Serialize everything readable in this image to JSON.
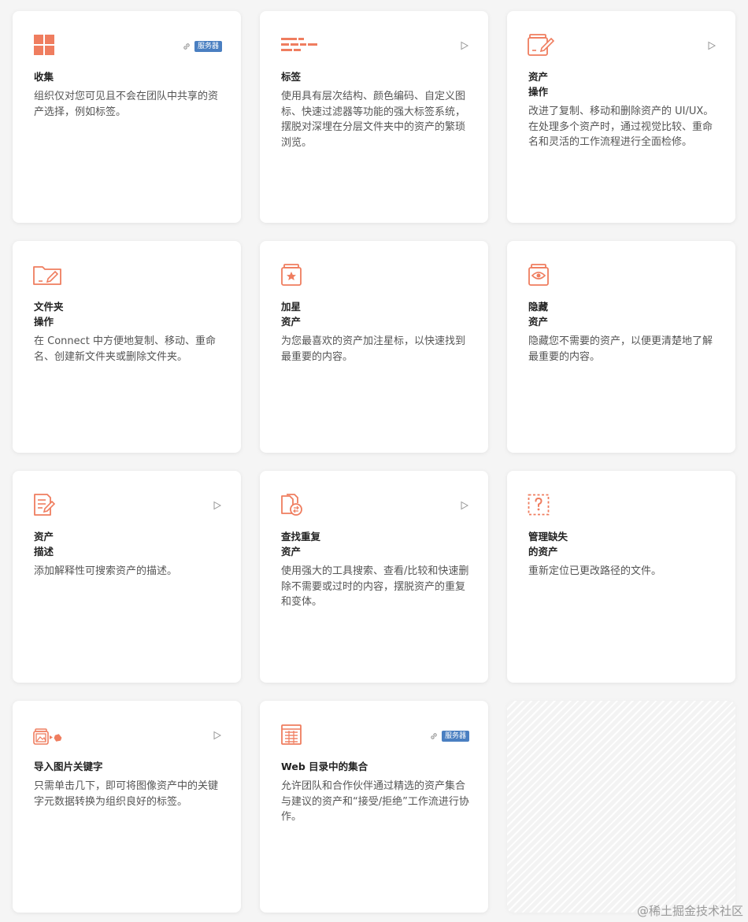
{
  "cards": [
    {
      "title1": "收集",
      "title2": "",
      "desc": "组织仅对您可见且不会在团队中共享的资产选择，例如标签。",
      "corner": "link-badge",
      "badge": "服务器",
      "icon": "grid-icon"
    },
    {
      "title1": "标签",
      "title2": "",
      "desc": "使用具有层次结构、颜色编码、自定义图标、快速过滤器等功能的强大标签系统，摆脱对深埋在分层文件夹中的资产的繁琐浏览。",
      "corner": "play",
      "icon": "tags-icon"
    },
    {
      "title1": "资产",
      "title2": "操作",
      "desc": "改进了复制、移动和删除资产的 UI/UX。在处理多个资产时，通过视觉比较、重命名和灵活的工作流程进行全面检修。",
      "corner": "play",
      "icon": "asset-edit-icon"
    },
    {
      "title1": "文件夹",
      "title2": "操作",
      "desc": "在 Connect 中方便地复制、移动、重命名、创建新文件夹或删除文件夹。",
      "corner": "none",
      "icon": "folder-edit-icon"
    },
    {
      "title1": "加星",
      "title2": "资产",
      "desc": "为您最喜欢的资产加注星标，以快速找到最重要的内容。",
      "corner": "none",
      "icon": "star-asset-icon"
    },
    {
      "title1": "隐藏",
      "title2": "资产",
      "desc": "隐藏您不需要的资产，以便更清楚地了解最重要的内容。",
      "corner": "none",
      "icon": "hidden-asset-icon"
    },
    {
      "title1": "资产",
      "title2": "描述",
      "desc": "添加解释性可搜索资产的描述。",
      "corner": "play",
      "icon": "description-icon"
    },
    {
      "title1": "查找重复",
      "title2": "资产",
      "desc": "使用强大的工具搜索、查看/比较和快速删除不需要或过时的内容，摆脱资产的重复和变体。",
      "corner": "play",
      "icon": "duplicate-icon"
    },
    {
      "title1": "管理缺失",
      "title2": "的资产",
      "desc": "重新定位已更改路径的文件。",
      "corner": "none",
      "icon": "missing-asset-icon"
    },
    {
      "title1": "导入图片关键字",
      "title2": "",
      "desc": "只需单击几下，即可将图像资产中的关键字元数据转换为组织良好的标签。",
      "corner": "play",
      "icon": "image-keyword-icon"
    },
    {
      "title1": "Web 目录中的集合",
      "title2": "",
      "desc": "允许团队和合作伙伴通过精选的资产集合与建议的资产和“接受/拒绝”工作流进行协作。",
      "corner": "link-badge",
      "badge": "服务器",
      "icon": "web-catalog-icon"
    }
  ],
  "watermark": "@稀土掘金技术社区",
  "accent_color": "#ef7d5f"
}
